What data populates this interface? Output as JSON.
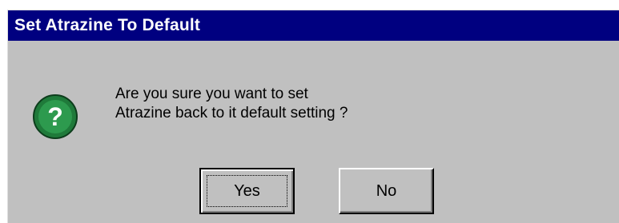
{
  "window": {
    "title": "Set Atrazine To Default"
  },
  "icon": {
    "name": "question-icon",
    "glyph": "?",
    "color": "#1f7a3a"
  },
  "message": {
    "line1": "Are you sure you want to set",
    "line2": "Atrazine back to it default setting ?"
  },
  "buttons": {
    "yes_label": "Yes",
    "no_label": "No"
  },
  "colors": {
    "titlebar": "#000080",
    "dialog_bg": "#c0c0c0"
  }
}
